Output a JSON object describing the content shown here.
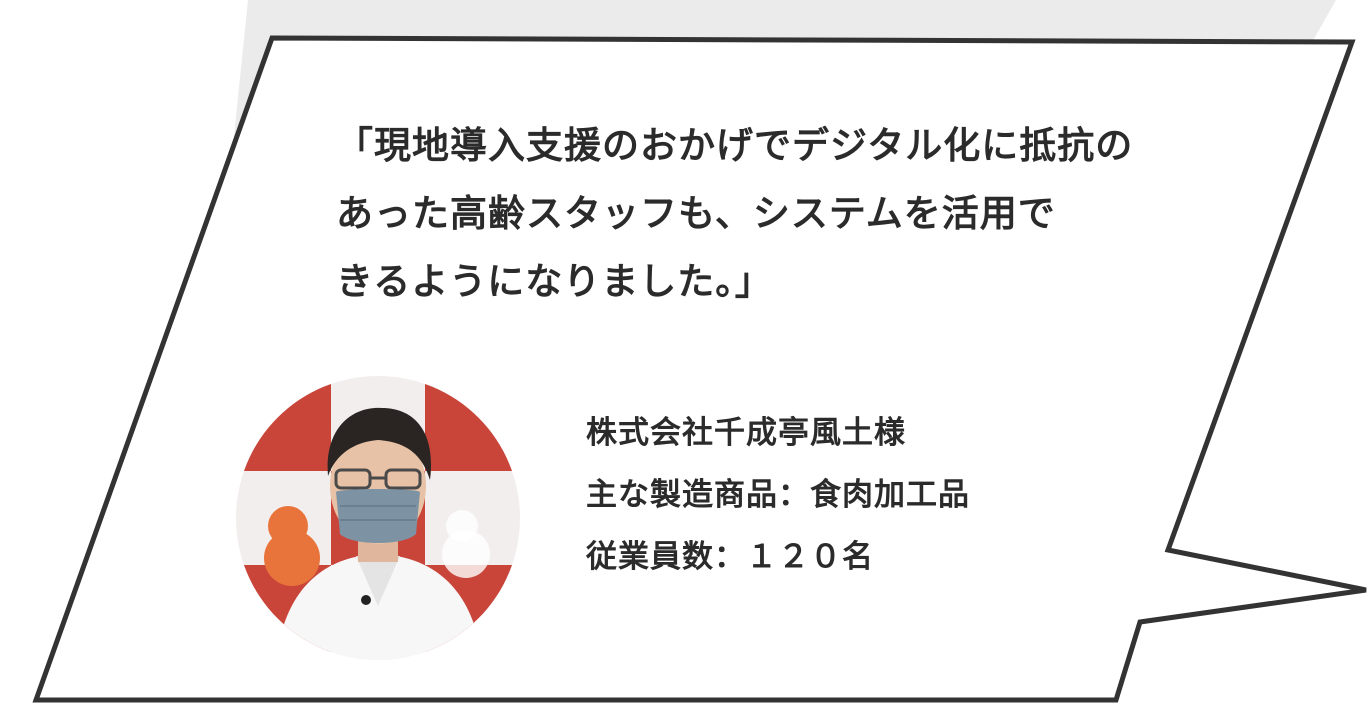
{
  "quote": {
    "lines": [
      "「現地導入支援のおかげでデジタル化に抵抗の",
      "あった高齢スタッフも、システムを活用で",
      "きるようになりました。」"
    ]
  },
  "company": {
    "name": "株式会社千成亭風土様",
    "products": "主な製造商品：食肉加工品",
    "employees": "従業員数：１２０名"
  },
  "colors": {
    "shadow": "#ebebeb",
    "border": "#333333",
    "text": "#2b2b2b",
    "accent_red": "#c0392b",
    "accent_orange": "#e8743b"
  },
  "icons": {
    "avatar": "person-photo-icon"
  }
}
